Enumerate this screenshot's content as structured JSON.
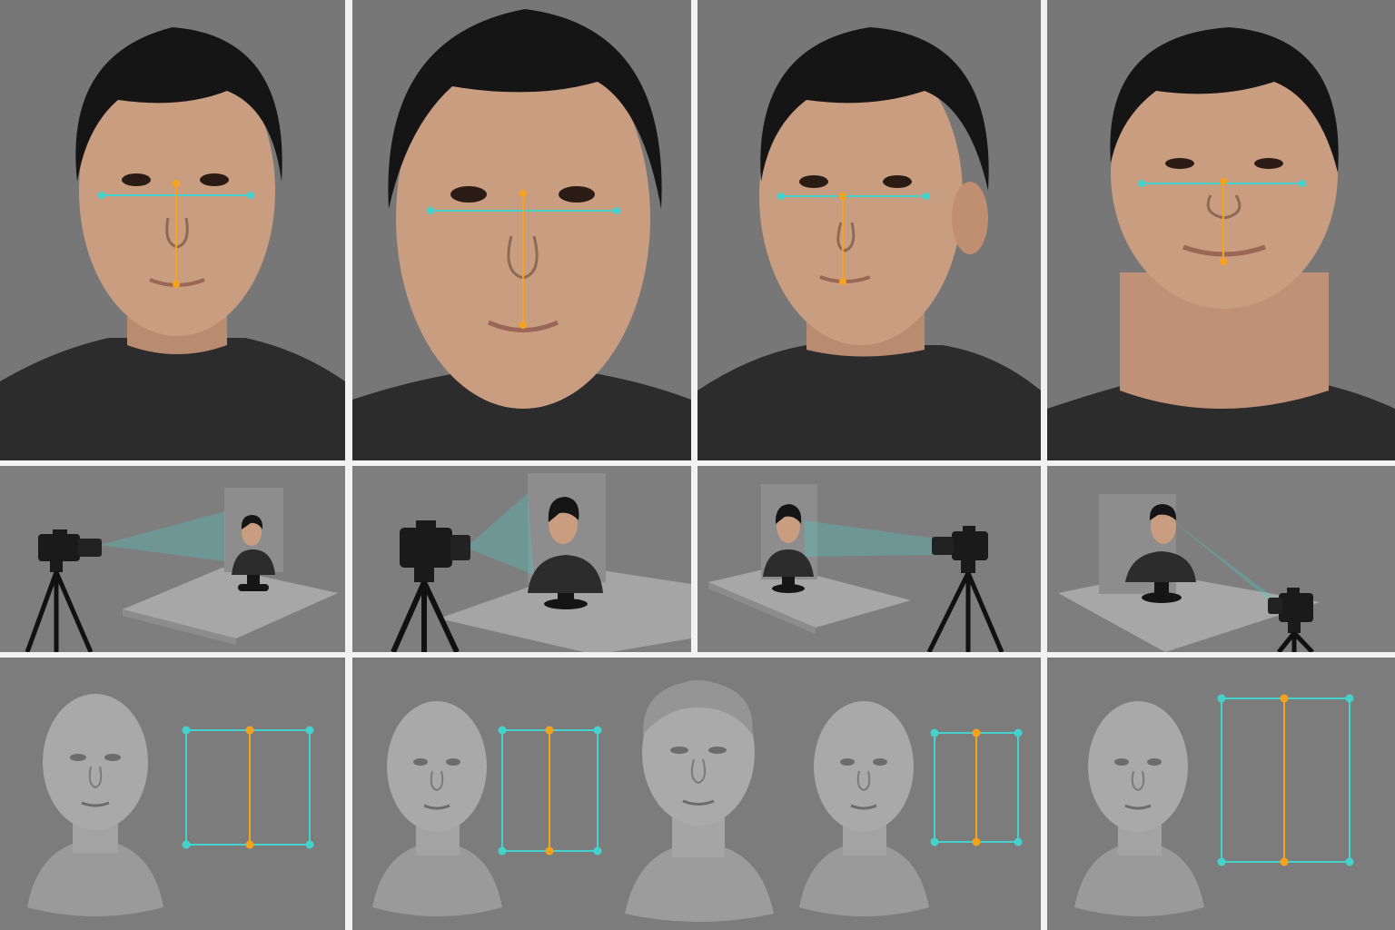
{
  "colors": {
    "background": "#7a7a7a",
    "panel_bg_top": "#777777",
    "panel_bg_mid": "#7e7e7e",
    "panel_bg_bottom": "#7c7c7c",
    "divider": "#f2f2f2",
    "cyan": "#43d3cc",
    "orange": "#f7a21c",
    "skin": "#c99d80",
    "hair": "#151515",
    "shirt": "#2c2c2c",
    "bust": "#a9a9a9",
    "camera": "#1a1a1a"
  },
  "rows": {
    "portraits": [
      {
        "name": "front",
        "icon": "portrait-front"
      },
      {
        "name": "close-up",
        "icon": "portrait-closeup"
      },
      {
        "name": "turned-left",
        "icon": "portrait-turned"
      },
      {
        "name": "tilted-up",
        "icon": "portrait-tilted"
      }
    ],
    "setups": [
      {
        "name": "camera-left-of-bust",
        "icon": "camera-tripod-icon"
      },
      {
        "name": "camera-front-of-bust",
        "icon": "camera-tripod-icon"
      },
      {
        "name": "camera-right-of-bust",
        "icon": "camera-tripod-icon"
      },
      {
        "name": "camera-low-right",
        "icon": "camera-tripod-icon"
      }
    ],
    "models": [
      {
        "name": "bust-with-frame",
        "icon": "head-bust-icon"
      },
      {
        "name": "bust-comparison",
        "icon": "head-bust-icon"
      },
      {
        "name": "bust-with-tall-frame",
        "icon": "head-bust-icon"
      }
    ]
  }
}
